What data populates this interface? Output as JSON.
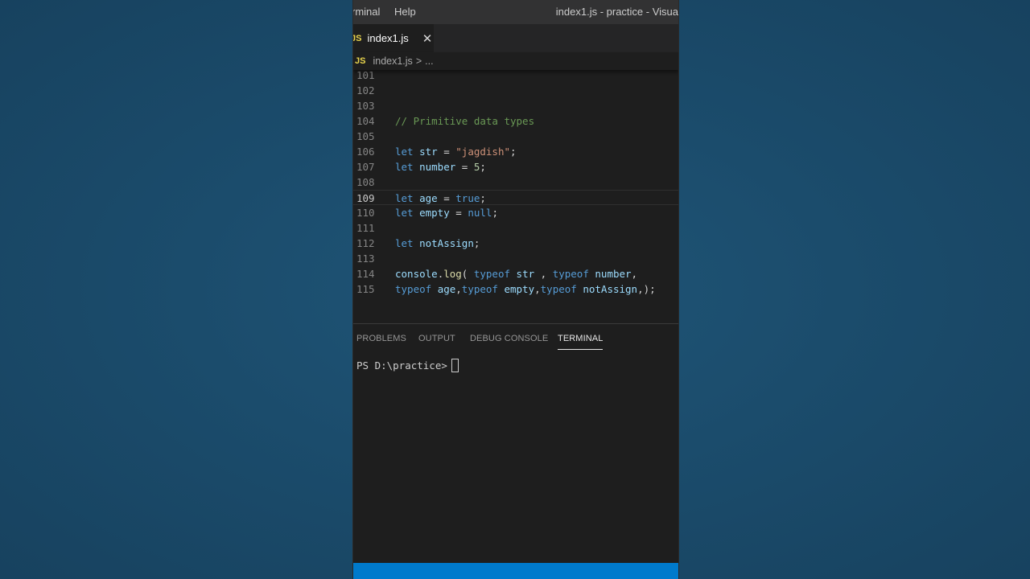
{
  "titlebar": {
    "menu": [
      "rminal",
      "Help"
    ],
    "window_title": "index1.js - practice - Visua"
  },
  "tab": {
    "icon_label": "JS",
    "filename": "index1.js",
    "close_glyph": "✕"
  },
  "breadcrumb": {
    "icon_label": "JS",
    "file": "index1.js",
    "separator": ">",
    "more": "..."
  },
  "editor": {
    "active_line": "109",
    "lines": [
      {
        "n": "101",
        "tokens": []
      },
      {
        "n": "102",
        "tokens": []
      },
      {
        "n": "103",
        "tokens": []
      },
      {
        "n": "104",
        "tokens": [
          [
            "cm",
            "// Primitive data types"
          ]
        ]
      },
      {
        "n": "105",
        "tokens": []
      },
      {
        "n": "106",
        "tokens": [
          [
            "kw",
            "let"
          ],
          [
            "p",
            " "
          ],
          [
            "var",
            "str"
          ],
          [
            "p",
            " = "
          ],
          [
            "str",
            "\"jagdish\""
          ],
          [
            "p",
            ";"
          ]
        ]
      },
      {
        "n": "107",
        "tokens": [
          [
            "kw",
            "let"
          ],
          [
            "p",
            " "
          ],
          [
            "var",
            "number"
          ],
          [
            "p",
            " = "
          ],
          [
            "num",
            "5"
          ],
          [
            "p",
            ";"
          ]
        ]
      },
      {
        "n": "108",
        "tokens": []
      },
      {
        "n": "109",
        "tokens": [
          [
            "kw",
            "let"
          ],
          [
            "p",
            " "
          ],
          [
            "var",
            "age"
          ],
          [
            "p",
            " = "
          ],
          [
            "kw",
            "true"
          ],
          [
            "p",
            ";"
          ]
        ]
      },
      {
        "n": "110",
        "tokens": [
          [
            "kw",
            "let"
          ],
          [
            "p",
            " "
          ],
          [
            "var",
            "empty"
          ],
          [
            "p",
            " = "
          ],
          [
            "kw",
            "null"
          ],
          [
            "p",
            ";"
          ]
        ]
      },
      {
        "n": "111",
        "tokens": []
      },
      {
        "n": "112",
        "tokens": [
          [
            "kw",
            "let"
          ],
          [
            "p",
            " "
          ],
          [
            "var",
            "notAssign"
          ],
          [
            "p",
            ";"
          ]
        ]
      },
      {
        "n": "113",
        "tokens": []
      },
      {
        "n": "114",
        "tokens": [
          [
            "var",
            "console"
          ],
          [
            "p",
            "."
          ],
          [
            "fn",
            "log"
          ],
          [
            "p",
            "( "
          ],
          [
            "kw",
            "typeof"
          ],
          [
            "p",
            " "
          ],
          [
            "var",
            "str"
          ],
          [
            "p",
            " , "
          ],
          [
            "kw",
            "typeof"
          ],
          [
            "p",
            " "
          ],
          [
            "var",
            "number"
          ],
          [
            "p",
            ","
          ]
        ]
      },
      {
        "n": "115",
        "tokens": [
          [
            "kw",
            "typeof"
          ],
          [
            "p",
            " "
          ],
          [
            "var",
            "age"
          ],
          [
            "p",
            ","
          ],
          [
            "kw",
            "typeof"
          ],
          [
            "p",
            " "
          ],
          [
            "var",
            "empty"
          ],
          [
            "p",
            ","
          ],
          [
            "kw",
            "typeof"
          ],
          [
            "p",
            " "
          ],
          [
            "var",
            "notAssign"
          ],
          [
            "p",
            ",);"
          ]
        ]
      }
    ]
  },
  "panel": {
    "tabs": [
      "PROBLEMS",
      "OUTPUT",
      "DEBUG CONSOLE",
      "TERMINAL"
    ],
    "active_tab": "TERMINAL",
    "terminal_prompt": "PS D:\\practice>"
  },
  "colors": {
    "background": "#1b4c6c",
    "editor_bg": "#1e1e1e",
    "status_bar": "#007acc",
    "keyword": "#569cd6",
    "variable": "#9cdcfe",
    "string": "#ce9178",
    "number": "#b5cea8",
    "comment": "#6a9955",
    "function": "#dcdcaa"
  }
}
